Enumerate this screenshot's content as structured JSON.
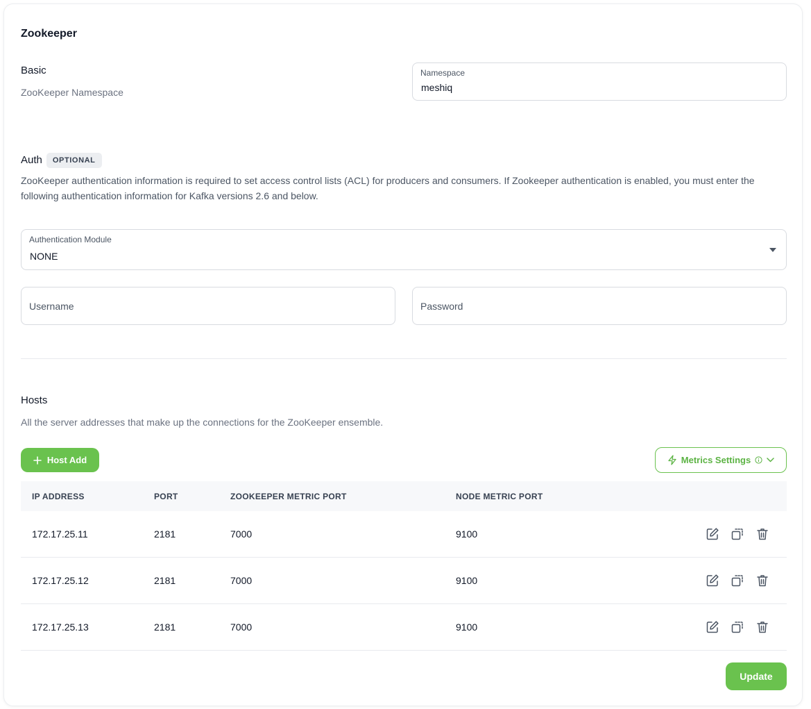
{
  "page": {
    "title": "Zookeeper"
  },
  "basic": {
    "title": "Basic",
    "subtitle": "ZooKeeper Namespace",
    "namespace_label": "Namespace",
    "namespace_value": "meshiq"
  },
  "auth": {
    "title": "Auth",
    "badge": "OPTIONAL",
    "description": "ZooKeeper authentication information is required to set access control lists (ACL) for producers and consumers. If Zookeeper authentication is enabled, you must enter the following authentication information for Kafka versions 2.6 and below.",
    "module_label": "Authentication Module",
    "module_value": "NONE",
    "username_placeholder": "Username",
    "password_placeholder": "Password"
  },
  "hosts": {
    "title": "Hosts",
    "description": "All the server addresses that make up the connections for the ZooKeeper ensemble.",
    "add_button": "Host Add",
    "metrics_button": "Metrics Settings",
    "columns": [
      "IP ADDRESS",
      "PORT",
      "ZOOKEEPER METRIC PORT",
      "NODE METRIC PORT"
    ],
    "rows": [
      {
        "ip": "172.17.25.11",
        "port": "2181",
        "zk_metric_port": "7000",
        "node_metric_port": "9100"
      },
      {
        "ip": "172.17.25.12",
        "port": "2181",
        "zk_metric_port": "7000",
        "node_metric_port": "9100"
      },
      {
        "ip": "172.17.25.13",
        "port": "2181",
        "zk_metric_port": "7000",
        "node_metric_port": "9100"
      }
    ]
  },
  "footer": {
    "update_button": "Update"
  },
  "colors": {
    "accent": "#6ac24e",
    "border": "#d8dbe0",
    "muted_text": "#6b7280"
  },
  "icons": [
    "plus-icon",
    "lightning-icon",
    "info-icon",
    "chevron-down-icon",
    "caret-down-icon",
    "edit-icon",
    "copy-icon",
    "trash-icon"
  ]
}
